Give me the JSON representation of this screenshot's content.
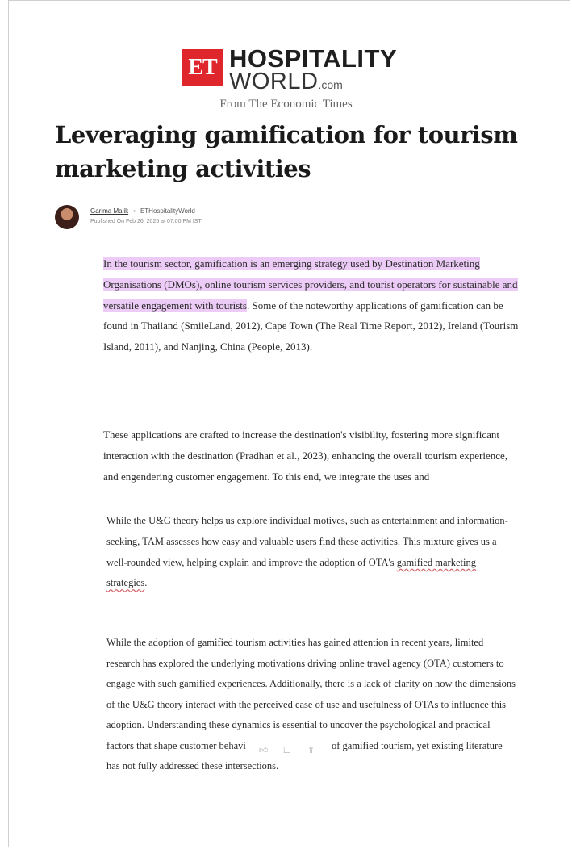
{
  "masthead": {
    "logo_mark": "ET",
    "brand_line1": "HOSPITALITY",
    "brand_line2": "WORLD",
    "brand_suffix": ".com",
    "tagline": "From The Economic Times"
  },
  "article": {
    "title": "Leveraging gamification for tourism marketing activities",
    "author": "Garima Malik",
    "separator": "•",
    "publication": "ETHospitalityWorld",
    "published": "Published On Feb 26, 2025 at 07:00 PM IST",
    "p1_highlight": "In the tourism sector, gamification is an emerging strategy used by Destination Marketing Organisations (DMOs), online tourism services providers, and tourist operators for sustainable and versatile engagement with tourists",
    "p1_rest": ". Some of the noteworthy applications of gamification can be found in Thailand (SmileLand, 2012), Cape Town (The Real Time Report, 2012), Ireland (Tourism Island, 2011), and Nanjing, China (People, 2013).",
    "p2": "These applications are crafted to increase the destination's visibility, fostering more significant interaction with the destination (Pradhan et al., 2023), enhancing the overall tourism experience, and engendering customer engagement. To this end, we integrate the uses and",
    "p3_start": "While the U&G theory helps us explore individual motives, such as entertainment and information-seeking, TAM assesses how easy and valuable users find these activities. This mixture gives us a well-rounded view, helping explain and improve the adoption of OTA's ",
    "p3_squiggle": "gamified marketing strategies",
    "p3_end": ".",
    "p4_start": "While the adoption of gamified tourism activities has gained attention in recent years, limited research has explored the underlying motivations driving online travel agency (OTA) customers to engage with such gamified experiences. Additionally, there is a lack of clarity on how the dimensions of the U&G theory interact with the perceived ease of use and usefulness of OTAs to influence this adoption. Understanding these dynamics is essential to uncover the psychological and practical factors that shape customer behavi",
    "p4_end": " of gamified tourism, yet existing literature has not fully addressed these intersections."
  },
  "icons": {
    "like": "thumbs-up-icon",
    "comment": "comment-icon",
    "share": "share-icon"
  },
  "colors": {
    "brand_red": "#e0262d",
    "highlight": "#eccbf6"
  }
}
